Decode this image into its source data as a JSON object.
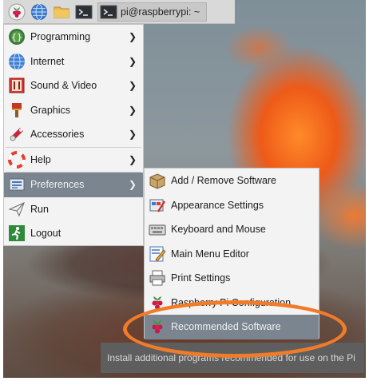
{
  "taskbar": {
    "launchers": [
      {
        "icon": "raspberry-menu-icon"
      },
      {
        "icon": "web-browser-icon"
      },
      {
        "icon": "file-manager-icon"
      },
      {
        "icon": "terminal-icon"
      }
    ],
    "window_button": {
      "icon": "terminal-icon",
      "label": "pi@raspberrypi: ~"
    }
  },
  "menu": {
    "items": [
      {
        "label": "Programming",
        "icon": "programming-icon",
        "has_submenu": true
      },
      {
        "label": "Internet",
        "icon": "internet-globe-icon",
        "has_submenu": true
      },
      {
        "label": "Sound & Video",
        "icon": "sound-video-icon",
        "has_submenu": true
      },
      {
        "label": "Graphics",
        "icon": "graphics-brush-icon",
        "has_submenu": true
      },
      {
        "label": "Accessories",
        "icon": "accessories-icon",
        "has_submenu": true
      },
      {
        "label": "Help",
        "icon": "help-lifebuoy-icon",
        "has_submenu": true
      },
      {
        "label": "Preferences",
        "icon": "preferences-icon",
        "has_submenu": true,
        "active": true
      },
      {
        "label": "Run",
        "icon": "run-paper-plane-icon",
        "has_submenu": false
      },
      {
        "label": "Logout",
        "icon": "logout-running-man-icon",
        "has_submenu": false
      }
    ]
  },
  "submenu": {
    "items": [
      {
        "label": "Add / Remove Software",
        "icon": "package-box-icon"
      },
      {
        "label": "Appearance Settings",
        "icon": "appearance-palette-icon"
      },
      {
        "label": "Keyboard and Mouse",
        "icon": "keyboard-mouse-icon"
      },
      {
        "label": "Main Menu Editor",
        "icon": "menu-editor-icon"
      },
      {
        "label": "Print Settings",
        "icon": "printer-icon"
      },
      {
        "label": "Raspberry Pi Configuration",
        "icon": "raspberry-icon"
      },
      {
        "label": "Recommended Software",
        "icon": "raspberry-icon",
        "active": true
      }
    ]
  },
  "tooltip": {
    "text": "Install additional programs recommended for use on the Pi"
  },
  "colors": {
    "menu_bg": "#f3f3f3",
    "highlight": "#7a8590",
    "tooltip_bg": "#5e5e5e",
    "annotation": "#f07c2a"
  }
}
